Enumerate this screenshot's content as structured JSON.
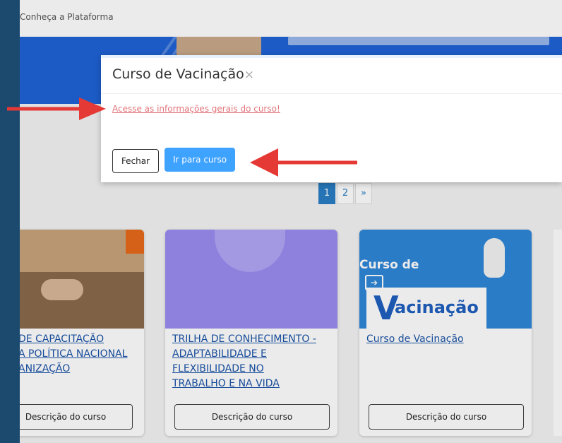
{
  "topbar": {
    "label": "Conheça a Plataforma"
  },
  "modal": {
    "title": "Curso de Vacinação",
    "close_icon": "×",
    "link": "Acesse as informações gerais do curso!",
    "close_button": "Fechar",
    "go_button": "Ir para curso"
  },
  "pagination": {
    "pages": [
      "1",
      "2",
      "»"
    ],
    "active": "1"
  },
  "cards": [
    {
      "title_lines": [
        "DE CAPACITAÇÃO",
        "A POLÍTICA NACIONAL",
        "ANIZAÇÃO"
      ],
      "desc": "Descrição do curso"
    },
    {
      "title_lines": [
        "TRILHA DE CONHECIMENTO -",
        "ADAPTABILIDADE E",
        "FLEXIBILIDADE NO",
        "TRABALHO E NA VIDA"
      ],
      "desc": "Descrição do curso"
    },
    {
      "title_lines": [
        "Curso de Vacinação"
      ],
      "thumb_text": [
        "Curso de",
        "acinação"
      ],
      "desc": "Descrição do curso"
    }
  ],
  "colors": {
    "accent": "#3ea2ff",
    "link": "#e2747a",
    "annotation_arrow": "#e53935"
  }
}
